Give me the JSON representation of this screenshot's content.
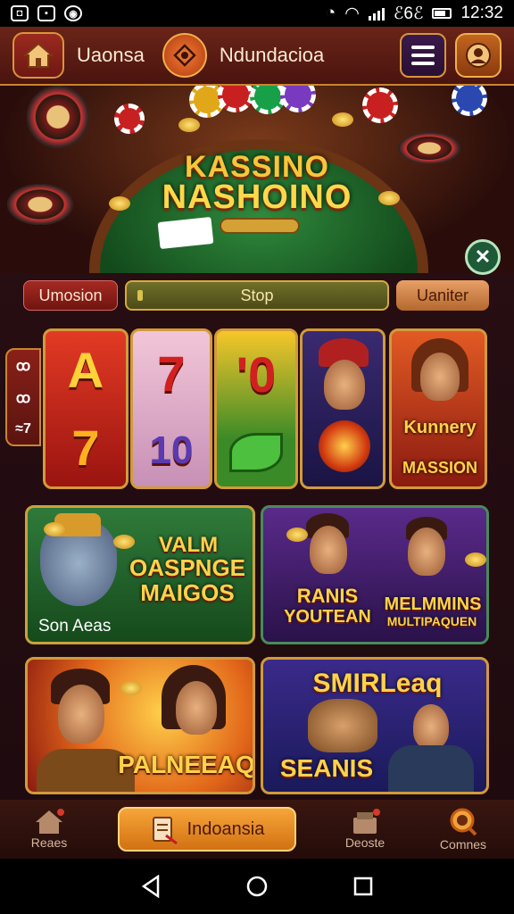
{
  "status_bar": {
    "network": "ℰ6ℰ",
    "time": "12:32"
  },
  "header": {
    "title": "Uaonsa",
    "subtitle": "Ndundacioa"
  },
  "hero": {
    "title_line1": "KASSINO",
    "title_line2": "NASHOINO"
  },
  "filters": {
    "left": "Umosion",
    "center": "Stop",
    "right": "Uaniter"
  },
  "side_tab": {
    "items": [
      "ꝏ",
      "ꝏ",
      "≈7"
    ]
  },
  "slots": {
    "reel1": {
      "top": "A",
      "bottom": "7"
    },
    "reel2": {
      "top": "7",
      "bottom": "10"
    },
    "reel3": {
      "top": "'0",
      "bottom": ""
    },
    "portrait_right": {
      "title_line1": "Kunnery",
      "title_line2": "MASSION"
    }
  },
  "games": [
    {
      "title_line1": "VALM",
      "title_line2": "OASPNGE",
      "title_line3": "MAIGOS",
      "caption": "Son Aeas"
    },
    {
      "title_line1": "RANIS",
      "title_line2": "YOUTEAN",
      "title_line3": "MELMMINS",
      "title_line4": "MULTIPAQUEN"
    },
    {
      "title": "PALNEEAQ"
    },
    {
      "title_line1": "SMIRLeaq",
      "title_line2": "SEANIS"
    }
  ],
  "bottom_nav": {
    "home": "Reaes",
    "cta": "Indoansia",
    "deposit": "Deoste",
    "search": "Comnes"
  },
  "colors": {
    "gold": "#d29a3a",
    "felt": "#2f8a3c",
    "crimson": "#8a2018"
  }
}
